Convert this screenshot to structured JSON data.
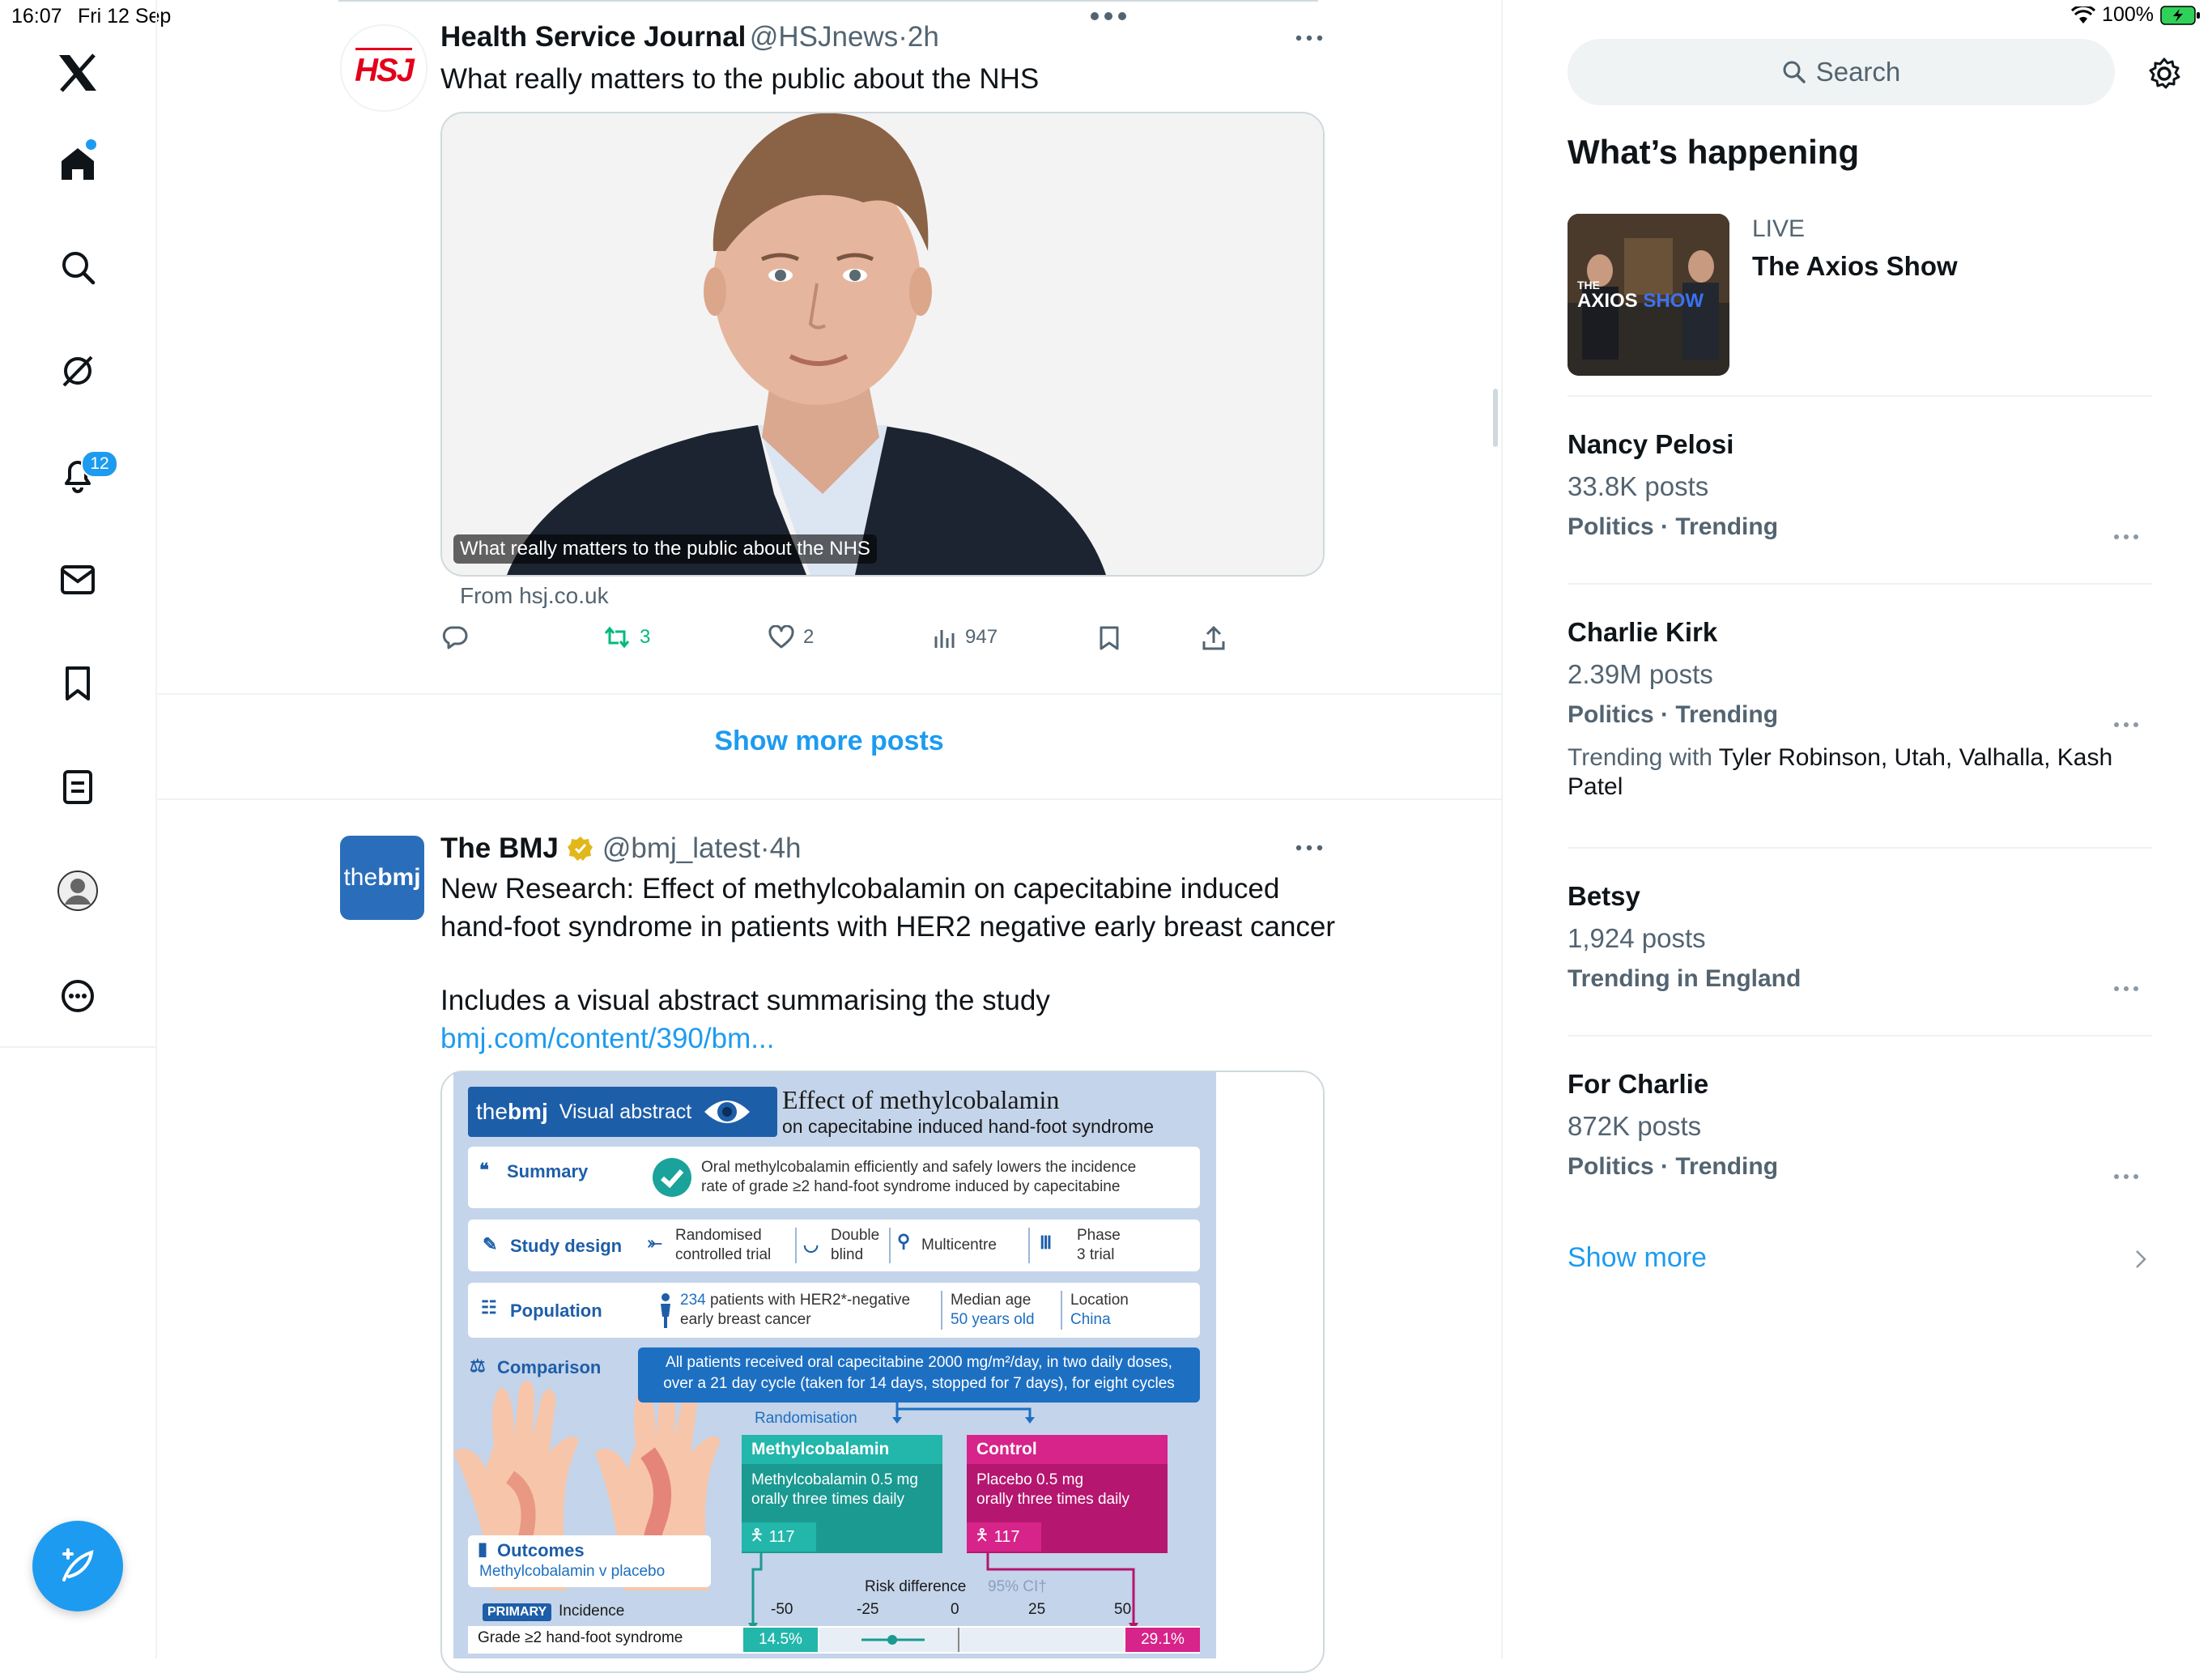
{
  "status_bar": {
    "time": "16:07",
    "date": "Fri 12 Sep",
    "battery": "100%"
  },
  "nav": {
    "notifications_badge": "12",
    "items": [
      "x-logo",
      "home",
      "explore",
      "grok",
      "notifications",
      "messages",
      "bookmarks",
      "lists",
      "profile",
      "more"
    ]
  },
  "tweet1": {
    "name": "Health Service Journal",
    "handle": "@HSJnews",
    "time": "2h",
    "text": "What really matters to the public about the NHS",
    "avatar_text": "HSJ",
    "card_caption": "What really matters to the public about the NHS",
    "source": "From hsj.co.uk",
    "reposts": "3",
    "likes": "2",
    "views": "947"
  },
  "show_more_posts": "Show more posts",
  "tweet2": {
    "name": "The BMJ",
    "handle": "@bmj_latest",
    "time": "4h",
    "avatar_text_thin": "the",
    "avatar_text_bold": "bmj",
    "text_line1": "New Research: Effect of methylcobalamin on capecitabine induced",
    "text_line2": "hand-foot syndrome in patients with HER2 negative early breast cancer",
    "text_line3": "Includes a visual abstract summarising the study",
    "link": "bmj.com/content/390/bm..."
  },
  "visual_abstract": {
    "brand_thin": "the",
    "brand_bold": "bmj",
    "brand_label": "Visual abstract",
    "title": "Effect of methylcobalamin",
    "subtitle": "on capecitabine induced hand-foot syndrome",
    "summary_label": "Summary",
    "summary_line1": "Oral methylcobalamin efficiently and safely lowers the incidence",
    "summary_line2": "rate of grade ≥2 hand-foot syndrome induced by capecitabine",
    "design_label": "Study design",
    "design_1a": "Randomised",
    "design_1b": "controlled trial",
    "design_2a": "Double",
    "design_2b": "blind",
    "design_3": "Multicentre",
    "design_4a": "Phase",
    "design_4b": "3 trial",
    "population_label": "Population",
    "pop_count": "234",
    "pop_line1_rest": " patients with HER2*-negative",
    "pop_line2": "early breast cancer",
    "median_age_label": "Median age",
    "median_age_value": "50 years old",
    "location_label": "Location",
    "location_value": "China",
    "comparison_label": "Comparison",
    "comparison_line1": "All patients received oral capecitabine 2000 mg/m²/day, in two daily doses,",
    "comparison_line2": "over a 21 day cycle (taken for 14 days, stopped for 7 days), for eight cycles",
    "randomisation": "Randomisation",
    "arm1_title": "Methylcobalamin",
    "arm1_line1": "Methylcobalamin 0.5 mg",
    "arm1_line2": "orally three times daily",
    "arm1_n": "117",
    "arm2_title": "Control",
    "arm2_line1": "Placebo 0.5 mg",
    "arm2_line2": "orally three times daily",
    "arm2_n": "117",
    "outcomes_label": "Outcomes",
    "outcomes_sub": "Methylcobalamin v placebo",
    "primary_tag": "PRIMARY",
    "incidence": "Incidence",
    "risk_diff": "Risk difference",
    "ci": "95% CI†",
    "ticks": [
      "-50",
      "-25",
      "0",
      "25",
      "50"
    ],
    "grade_label": "Grade ≥2 hand-foot syndrome",
    "val_left": "14.5%",
    "val_right": "29.1%"
  },
  "right_panel": {
    "search_placeholder": "Search",
    "heading": "What’s happening",
    "live_label": "LIVE",
    "live_title": "The Axios Show",
    "live_thumb_small": "THE",
    "live_thumb_brand": "AXIOS",
    "live_thumb_show": "SHOW",
    "trends": [
      {
        "name": "Nancy Pelosi",
        "count": "33.8K posts",
        "category": "Politics · Trending"
      },
      {
        "name": "Charlie Kirk",
        "count": "2.39M posts",
        "category": "Politics · Trending",
        "with_label": "Trending with ",
        "with_line1": "Tyler Robinson, Utah, Valhalla, Kash",
        "with_line2": "Patel"
      },
      {
        "name": "Betsy",
        "count": "1,924 posts",
        "category": "Trending in England"
      },
      {
        "name": "For Charlie",
        "count": "872K posts",
        "category": "Politics · Trending"
      }
    ],
    "show_more": "Show more"
  },
  "colors": {
    "accent": "#1d9bf0",
    "repost_green": "#00ba7c",
    "bmj_blue": "#2a6ebb",
    "hsj_red": "#e3001b",
    "control_magenta": "#d6248a",
    "methyl_teal": "#1aa39a"
  }
}
